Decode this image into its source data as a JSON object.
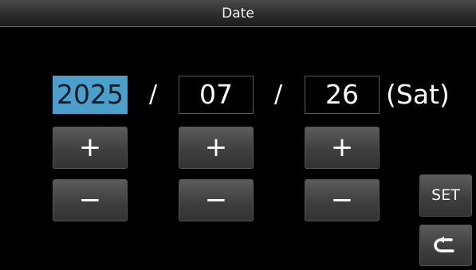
{
  "title": "Date",
  "date": {
    "year": "2025",
    "month": "07",
    "day": "26",
    "separator": "/",
    "weekday": "(Sat)",
    "selected_field": "year"
  },
  "buttons": {
    "plus_label": "+",
    "minus_label": "−",
    "set_label": "SET",
    "back_icon": "return-arrow-icon"
  },
  "colors": {
    "selected_field": "#4a9fcc",
    "button_face": "#4a4a4a",
    "background": "#000000"
  }
}
